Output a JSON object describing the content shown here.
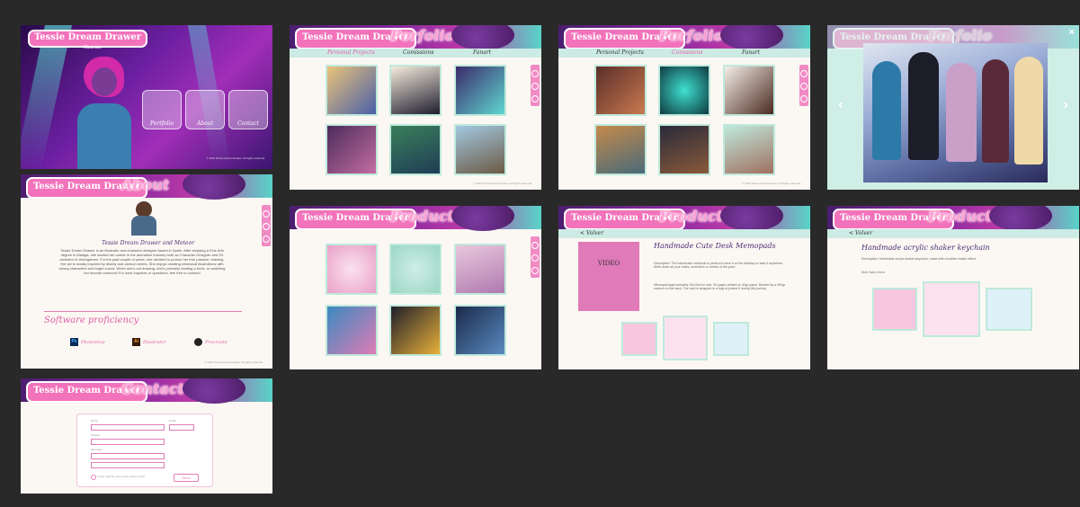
{
  "brand": "Tessie Dream Drawer",
  "home": {
    "subtitle": "Illustrator",
    "buttons": [
      "Portfolio",
      "About",
      "Contact"
    ],
    "footer": "© 2021 Tessie Dream Drawer. All rights reserved."
  },
  "portfolio1": {
    "title": "Porfolio",
    "tabs": [
      "Personal Projects",
      "Comissions",
      "Fanart"
    ],
    "active": 0
  },
  "portfolio2": {
    "title": "Porfolio",
    "tabs": [
      "Personal Projects",
      "Comissions",
      "Fanart"
    ],
    "active": 1
  },
  "portfolio3": {
    "title": "Porfolio"
  },
  "about": {
    "title": "About",
    "name": "Tessie Dream Drawer and Meteor",
    "bio": "Tessie Dream Drawer is an illustrator and character designer based in Spain. After studying a Fine Arts degree in Malaga, she started her career in the animation industry both as Character Designer and 2D animator in videogames. For the past couple of years, she decided to pursue her true passion: drawing. Her art is mostly inspired by disney and cartoon series. She enjoys creating whimsical illustrations with strong characters and bright colors. When she's not drawing, she's probably reading a book, re-watching her favorite cartoons! For work inquiries or questions, feel free to contact!",
    "software_heading": "Software proficiency",
    "software": [
      "Photoshop",
      "Illustrator",
      "Procreate"
    ]
  },
  "products1": {
    "title": "Products"
  },
  "products2": {
    "title": "Products",
    "back": "< Volver",
    "video": "VIDEO",
    "product": "Handmade Cute Desk Memopads",
    "description": "Description: The handmade notebook is perfect to have it on the desktop or take it anywhere. Write down all your notes, reminders or events of the year!",
    "details": "Memopad approximately 10x10cm in size. 50 pages printed on 90gr paper. Backed by a 300gr cartoon on the back. The card is wrapped in a bag to protect it during the journey."
  },
  "products3": {
    "title": "Products",
    "back": "< Volver",
    "product": "Handmade acrylic shaker keychain",
    "description": "Description: Handmade acrylic shaker keychain, made with a bubble shaker effect.",
    "size": "Size: 6cm x 6cm"
  },
  "contact": {
    "title": "Contact",
    "fields": [
      "Name",
      "Email",
      "Subject",
      "Message"
    ],
    "checkbox": "I have read the terms and privacy policy",
    "send": "Send"
  },
  "lightbox": {
    "close": "×",
    "prev": "‹",
    "next": "›"
  },
  "colors": {
    "background": "#292929",
    "accent": "#f272bb",
    "purple": "#4a1e6e",
    "teal": "#58d4c8"
  }
}
